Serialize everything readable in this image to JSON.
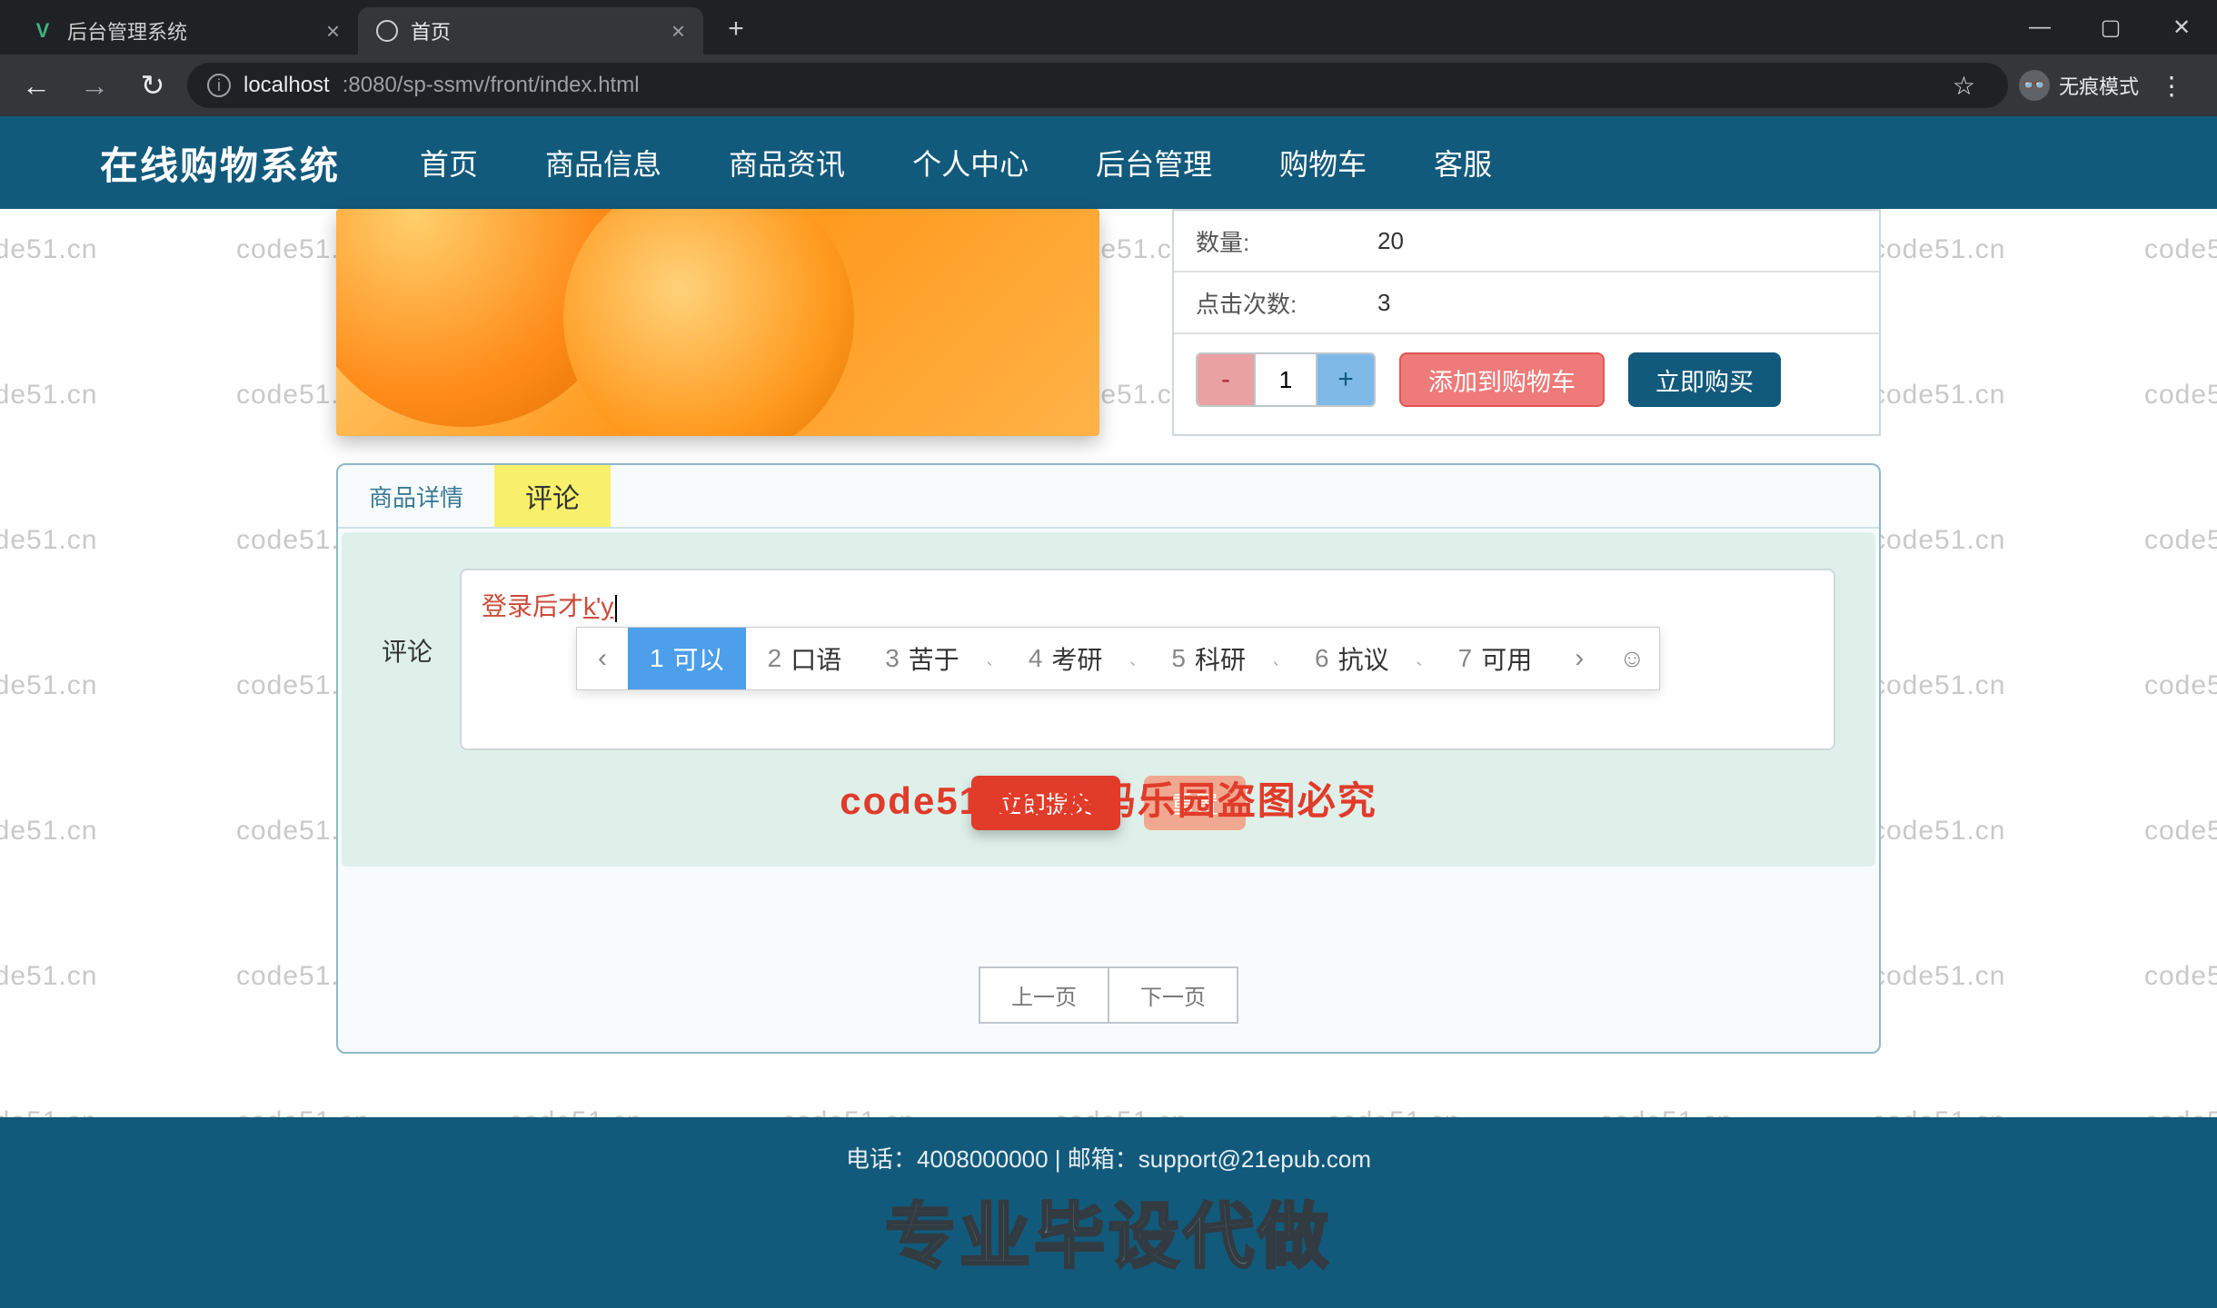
{
  "browser": {
    "tabs": [
      {
        "title": "后台管理系统",
        "icon": "V"
      },
      {
        "title": "首页",
        "icon": "globe"
      }
    ],
    "window_controls": {
      "min": "—",
      "max": "▢",
      "close": "✕"
    },
    "nav": {
      "back": "←",
      "forward": "→",
      "reload": "↻"
    },
    "url_host": "localhost",
    "url_rest": ":8080/sp-ssmv/front/index.html",
    "incognito_label": "无痕模式",
    "star": "☆",
    "kebab": "⋮"
  },
  "site": {
    "brand": "在线购物系统",
    "menu": [
      "首页",
      "商品信息",
      "商品资讯",
      "个人中心",
      "后台管理",
      "购物车",
      "客服"
    ],
    "active_menu_index": 0
  },
  "product": {
    "rows": [
      {
        "label": "数量:",
        "value": "20"
      },
      {
        "label": "点击次数:",
        "value": "3"
      }
    ],
    "qty_value": "1",
    "minus": "-",
    "plus": "+",
    "add_cart": "添加到购物车",
    "buy_now": "立即购买"
  },
  "panel": {
    "tabs": [
      "商品详情",
      "评论"
    ],
    "active_tab_index": 1,
    "comment_label": "评论",
    "typed_prefix": "登录后才",
    "typed_pinyin": "k'y",
    "submit": "立即提交",
    "reset": "重置",
    "prev_page": "上一页",
    "next_page": "下一页"
  },
  "ime": {
    "candidates": [
      {
        "n": "1",
        "t": "可以"
      },
      {
        "n": "2",
        "t": "口语"
      },
      {
        "n": "3",
        "t": "苦于"
      },
      {
        "n": "4",
        "t": "考研"
      },
      {
        "n": "5",
        "t": "科研"
      },
      {
        "n": "6",
        "t": "抗议"
      },
      {
        "n": "7",
        "t": "可用"
      }
    ],
    "selected_index": 0,
    "left": "‹",
    "right": "›",
    "emoji": "☺"
  },
  "footer": {
    "contact": "电话：4008000000 | 邮箱：support@21epub.com",
    "big": "专业毕设代做"
  },
  "watermark_text": "code51.cn",
  "red_mark": "code51.cn-源码乐园盗图必究"
}
